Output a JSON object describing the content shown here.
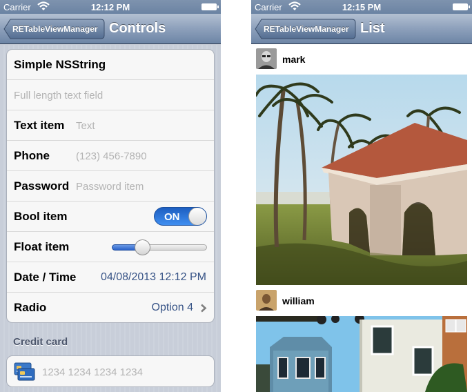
{
  "left_screen": {
    "status_bar": {
      "carrier": "Carrier",
      "time": "12:12 PM"
    },
    "nav": {
      "back_label": "RETableViewManager",
      "title": "Controls"
    },
    "rows": {
      "simple": {
        "title": "Simple NSString"
      },
      "full_text": {
        "placeholder": "Full length text field"
      },
      "text_item": {
        "title": "Text item",
        "placeholder": "Text"
      },
      "phone": {
        "title": "Phone",
        "placeholder": "(123) 456-7890"
      },
      "password": {
        "title": "Password",
        "placeholder": "Password item"
      },
      "bool_item": {
        "title": "Bool item",
        "switch_label": "ON",
        "value": true
      },
      "float_item": {
        "title": "Float item",
        "value": 0.32
      },
      "date_time": {
        "title": "Date / Time",
        "value": "04/08/2013 12:12 PM"
      },
      "radio": {
        "title": "Radio",
        "value": "Option 4"
      }
    },
    "credit_card": {
      "header": "Credit card",
      "placeholder": "1234 1234 1234 1234"
    },
    "colors": {
      "accent": "#385487",
      "switch_on": "#2f72d8"
    }
  },
  "right_screen": {
    "status_bar": {
      "carrier": "Carrier",
      "time": "12:15 PM"
    },
    "nav": {
      "back_label": "RETableViewManager",
      "title": "List"
    },
    "posts": [
      {
        "username": "mark",
        "photo": "palm-trees-gazebo-photo"
      },
      {
        "username": "william",
        "photo": "victorian-houses-photo"
      }
    ]
  }
}
